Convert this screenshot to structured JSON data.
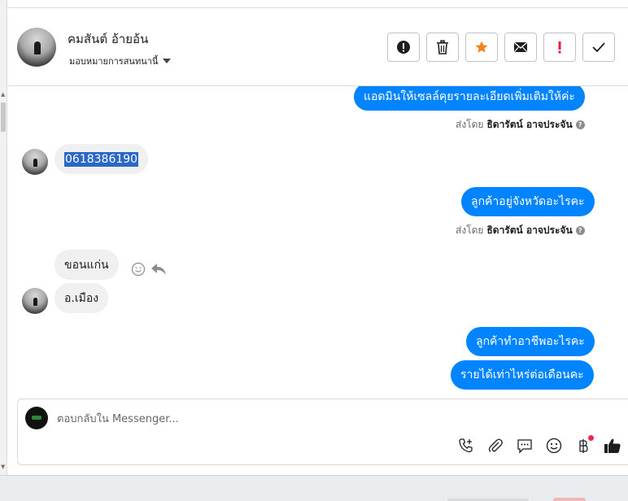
{
  "header": {
    "contact_name": "คมสันต์ อ้ายอ้น",
    "assign_label": "มอบหมายการสนทนานี้"
  },
  "actions": [
    {
      "name": "spam-button",
      "icon": "exclamation-circle-icon"
    },
    {
      "name": "delete-button",
      "icon": "trash-icon"
    },
    {
      "name": "star-button",
      "icon": "star-icon",
      "color": "#f5821f"
    },
    {
      "name": "mark-unread-button",
      "icon": "envelope-icon"
    },
    {
      "name": "follow-up-button",
      "icon": "exclamation-icon",
      "color": "#e41e3f"
    },
    {
      "name": "done-button",
      "icon": "checkmark-icon"
    }
  ],
  "messages": {
    "m1": "แอดมินให้เซลล์คุยรายละเอียดเพิ่มเติมให้ค่ะ",
    "m2": "0618386190",
    "m3": "ลูกค้าอยู่จังหวัดอะไรคะ",
    "m4": "ขอนแก่น",
    "m5": "อ.เมือง",
    "m6": "ลูกค้าทำอาชีพอะไรคะ",
    "m7": "รายได้เท่าไหร่ต่อเดือนคะ"
  },
  "sent_by": {
    "prefix": "ส่งโดย",
    "agent": "ธิดารัตน์ อาจประจัน"
  },
  "composer": {
    "placeholder": "ตอบกลับใน Messenger..."
  },
  "tools": [
    "phone-plus-icon",
    "paperclip-icon",
    "saved-reply-icon",
    "emoji-icon",
    "baht-payment-icon",
    "thumbs-up-icon"
  ],
  "colors": {
    "outgoing_bubble": "#0084ff",
    "incoming_bubble": "#f0f0f0",
    "star": "#f5821f",
    "alert": "#e41e3f"
  }
}
